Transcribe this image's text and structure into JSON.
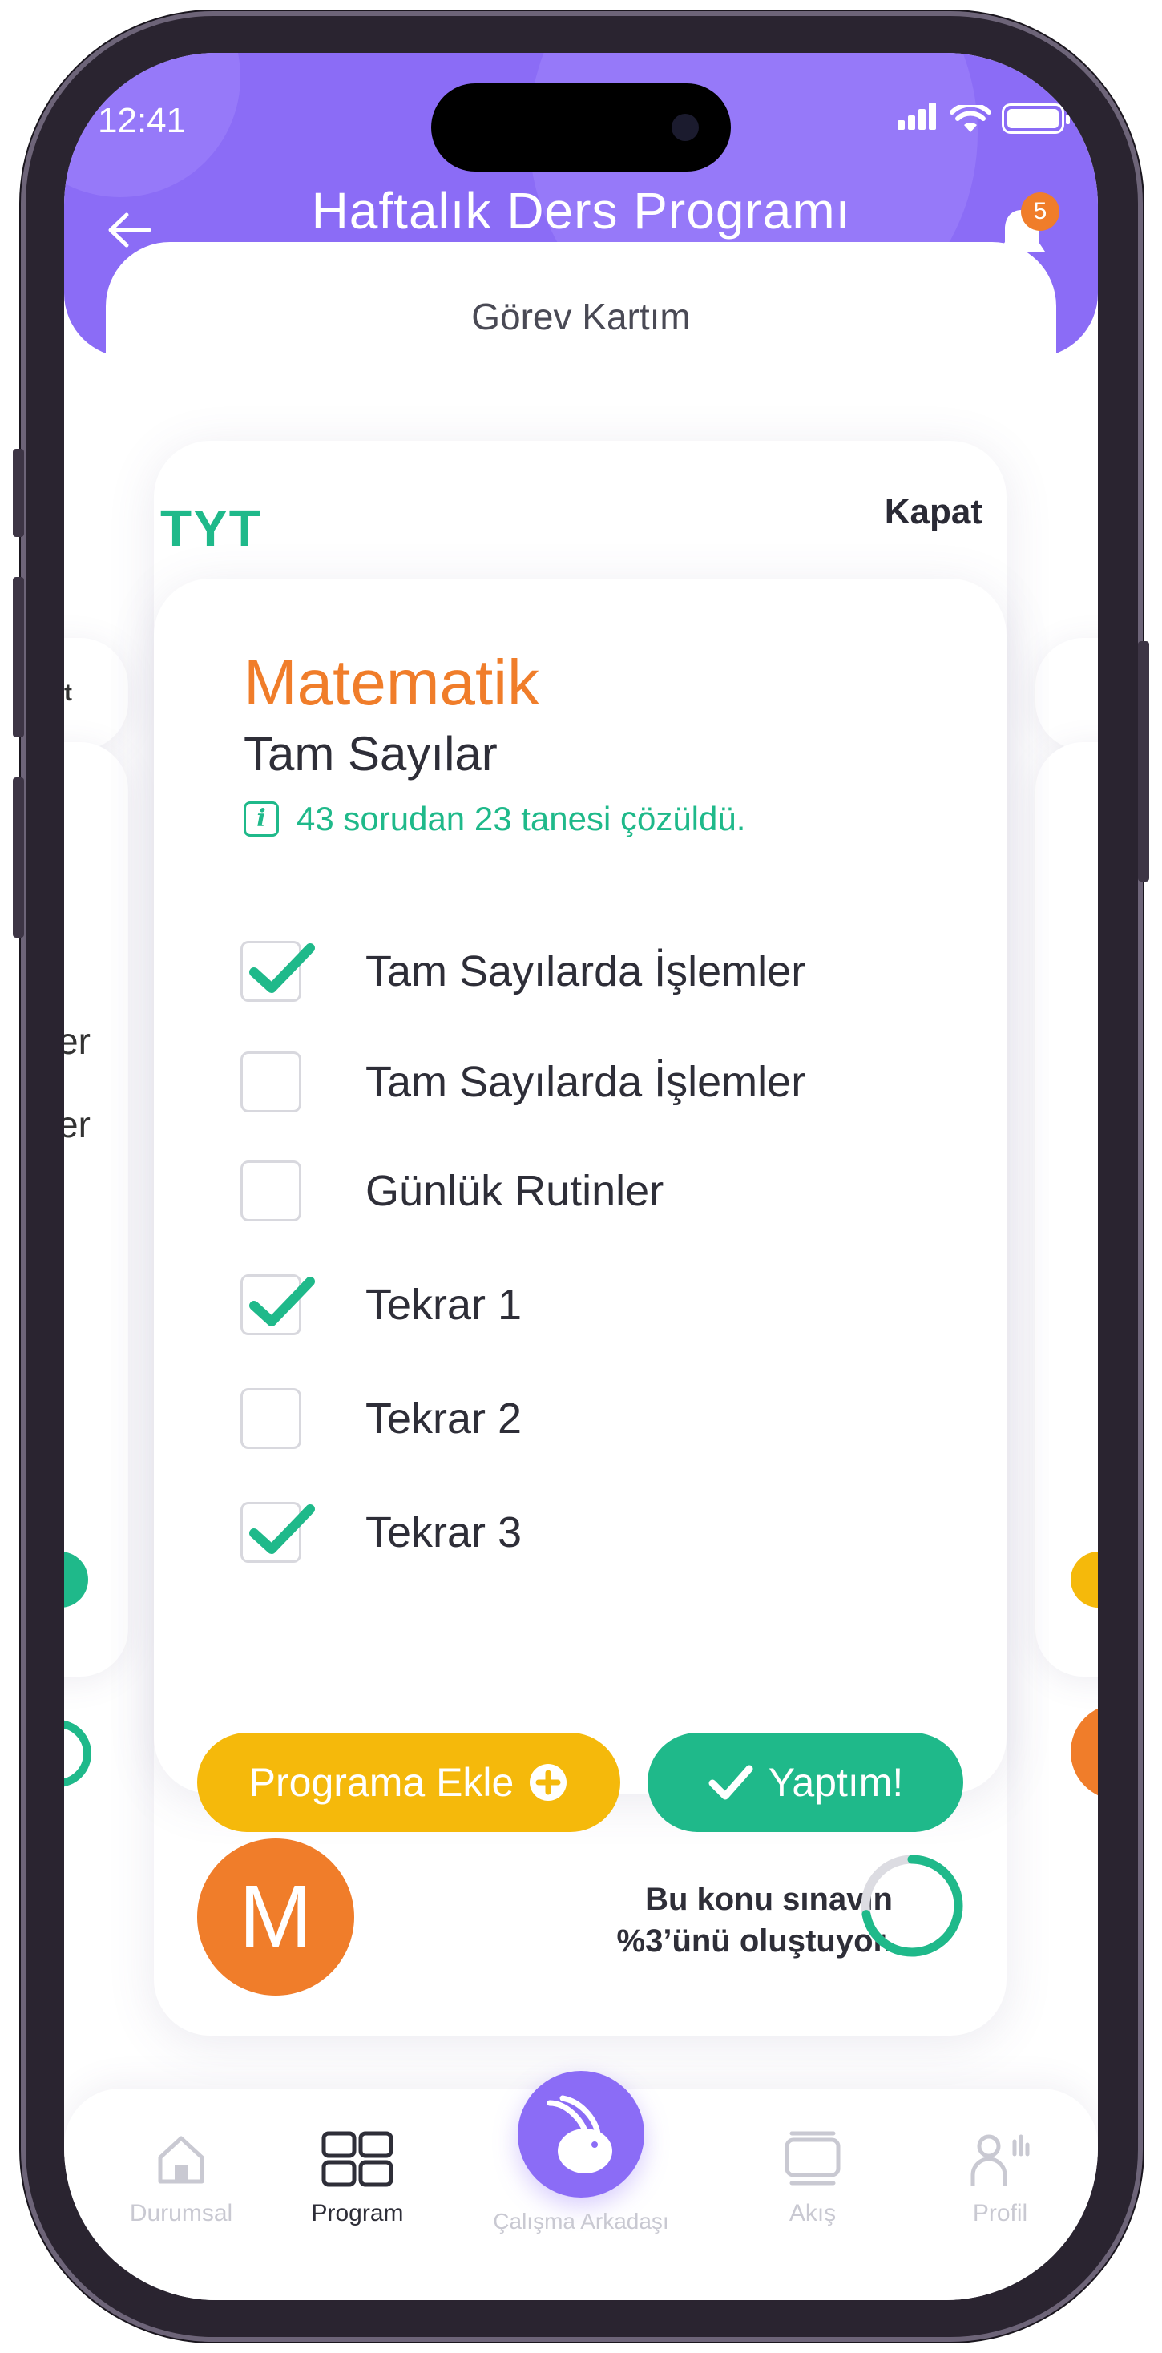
{
  "status_bar": {
    "time": "12:41"
  },
  "header": {
    "title": "Haftalık Ders Programı",
    "notification_count": "5"
  },
  "title_card": {
    "label": "Görev Kartım"
  },
  "card": {
    "exam": "TYT",
    "close_label": "Kapat",
    "subject": "Matematik",
    "topic": "Tam Sayılar",
    "info": "43 sorudan 23 tanesi çözüldü.",
    "tasks": [
      {
        "label": "Tam Sayılarda İşlemler",
        "checked": true
      },
      {
        "label": "Tam Sayılarda İşlemler",
        "checked": false
      },
      {
        "label": "Günlük Rutinler",
        "checked": false
      },
      {
        "label": "Tekrar 1",
        "checked": true
      },
      {
        "label": "Tekrar 2",
        "checked": false
      },
      {
        "label": "Tekrar 3",
        "checked": true
      }
    ],
    "add_button": "Programa Ekle",
    "done_button": "Yaptım!",
    "avatar_letter": "M",
    "share_line1": "Bu konu sınavın",
    "share_line2": "%3’ünü oluştuyor.",
    "share_percent": 3
  },
  "side_cards": {
    "left_fragment_1": "t",
    "left_fragment_2": "er",
    "left_fragment_3": "er"
  },
  "nav": {
    "items": [
      {
        "label": "Durumsal",
        "icon": "home-icon",
        "active": false
      },
      {
        "label": "Program",
        "icon": "grid-icon",
        "active": true
      },
      {
        "label": "Çalışma Arkadaşı",
        "icon": "rabbit-icon",
        "active": false
      },
      {
        "label": "Akış",
        "icon": "cards-icon",
        "active": false
      },
      {
        "label": "Profil",
        "icon": "profile-icon",
        "active": false
      }
    ]
  },
  "colors": {
    "header": "#8b6cf6",
    "green": "#1fb98a",
    "orange": "#f07d2a",
    "yellow": "#f5b90b"
  }
}
